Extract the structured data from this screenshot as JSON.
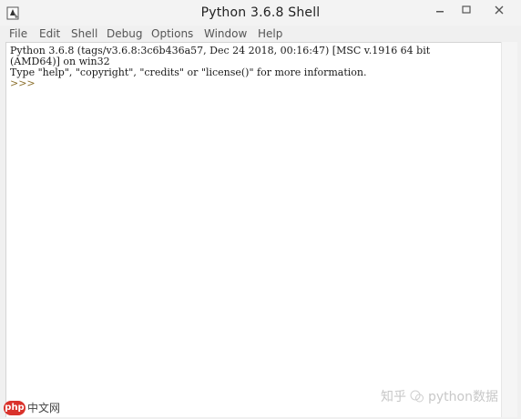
{
  "window": {
    "title": "Python 3.6.8 Shell"
  },
  "menu": {
    "items": [
      "File",
      "Edit",
      "Shell",
      "Debug",
      "Options",
      "Window",
      "Help"
    ]
  },
  "shell": {
    "banner_line1": "Python 3.6.8 (tags/v3.6.8:3c6b436a57, Dec 24 2018, 00:16:47) [MSC v.1916 64 bit",
    "banner_line2": "(AMD64)] on win32",
    "banner_line3": "Type \"help\", \"copyright\", \"credits\" or \"license()\" for more information.",
    "prompt": ">>>"
  },
  "watermarks": {
    "left_logo": "php",
    "left_text": "中文网",
    "right_text_1": "知乎",
    "right_text_2": "python数据"
  },
  "icons": {
    "app": "idle-app-icon",
    "minimize": "minimize-icon",
    "maximize": "maximize-icon",
    "close": "close-icon"
  }
}
